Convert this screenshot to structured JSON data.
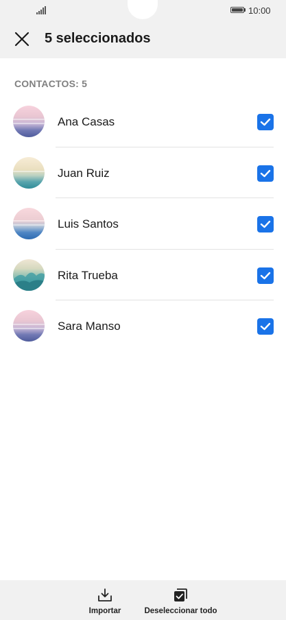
{
  "status_bar": {
    "time": "10:00",
    "icons": [
      "signal-icon",
      "battery-icon"
    ]
  },
  "header": {
    "title": "5 seleccionados",
    "close_icon": "close-icon"
  },
  "section": {
    "label": "CONTACTOS: 5"
  },
  "contacts": [
    {
      "name": "Ana Casas",
      "checked": true
    },
    {
      "name": "Juan Ruiz",
      "checked": true
    },
    {
      "name": "Luis Santos",
      "checked": true
    },
    {
      "name": "Rita Trueba",
      "checked": true
    },
    {
      "name": "Sara Manso",
      "checked": true
    }
  ],
  "bottom_bar": {
    "import_label": "Importar",
    "deselect_label": "Deseleccionar todo"
  },
  "colors": {
    "accent": "#1a73e8",
    "bar_background": "#f1f1f1"
  }
}
